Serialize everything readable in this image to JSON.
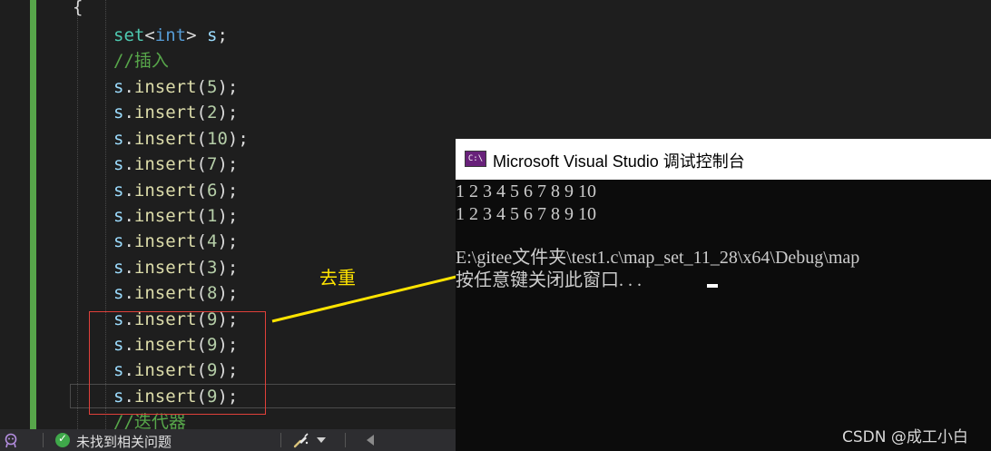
{
  "editor": {
    "open_brace": "{",
    "declaration": {
      "type": "set",
      "lt": "<",
      "template_arg": "int",
      "gt": ">",
      "name": " s",
      "end": ";"
    },
    "comment_insert": "//插入",
    "insert_calls": [
      {
        "obj": "s",
        "dot": ".",
        "method": "insert",
        "arg": "5"
      },
      {
        "obj": "s",
        "dot": ".",
        "method": "insert",
        "arg": "2"
      },
      {
        "obj": "s",
        "dot": ".",
        "method": "insert",
        "arg": "10"
      },
      {
        "obj": "s",
        "dot": ".",
        "method": "insert",
        "arg": "7"
      },
      {
        "obj": "s",
        "dot": ".",
        "method": "insert",
        "arg": "6"
      },
      {
        "obj": "s",
        "dot": ".",
        "method": "insert",
        "arg": "1"
      },
      {
        "obj": "s",
        "dot": ".",
        "method": "insert",
        "arg": "4"
      },
      {
        "obj": "s",
        "dot": ".",
        "method": "insert",
        "arg": "3"
      },
      {
        "obj": "s",
        "dot": ".",
        "method": "insert",
        "arg": "8"
      },
      {
        "obj": "s",
        "dot": ".",
        "method": "insert",
        "arg": "9"
      },
      {
        "obj": "s",
        "dot": ".",
        "method": "insert",
        "arg": "9"
      },
      {
        "obj": "s",
        "dot": ".",
        "method": "insert",
        "arg": "9"
      },
      {
        "obj": "s",
        "dot": ".",
        "method": "insert",
        "arg": "9"
      }
    ],
    "comment_iterator": "//迭代器",
    "syntax_colors": {
      "keyword": "#569cd6",
      "type": "#4ec9b0",
      "variable": "#9cdcfe",
      "function": "#dcdcaa",
      "number": "#b5cea8",
      "comment": "#57a64a"
    }
  },
  "annotation": {
    "label": "去重",
    "box_color": "#e0403a",
    "arrow_color": "#ffe400"
  },
  "console": {
    "icon_text": "C:\\",
    "title": "Microsoft Visual Studio 调试控制台",
    "lines": [
      "1 2 3 4 5 6 7 8 9 10",
      "1 2 3 4 5 6 7 8 9 10",
      "",
      "E:\\gitee文件夹\\test1.c\\map_set_11_28\\x64\\Debug\\map",
      "按任意键关闭此窗口. . ."
    ]
  },
  "statusbar": {
    "ai_icon": "copilot-icon",
    "status_icon": "check-circle-icon",
    "status_text": "未找到相关问题",
    "cleanup_icon": "brush-icon",
    "dropdown_icon": "chevron-down-icon",
    "scroll_icon": "scroll-left-icon"
  },
  "watermark": "CSDN @成工小白"
}
